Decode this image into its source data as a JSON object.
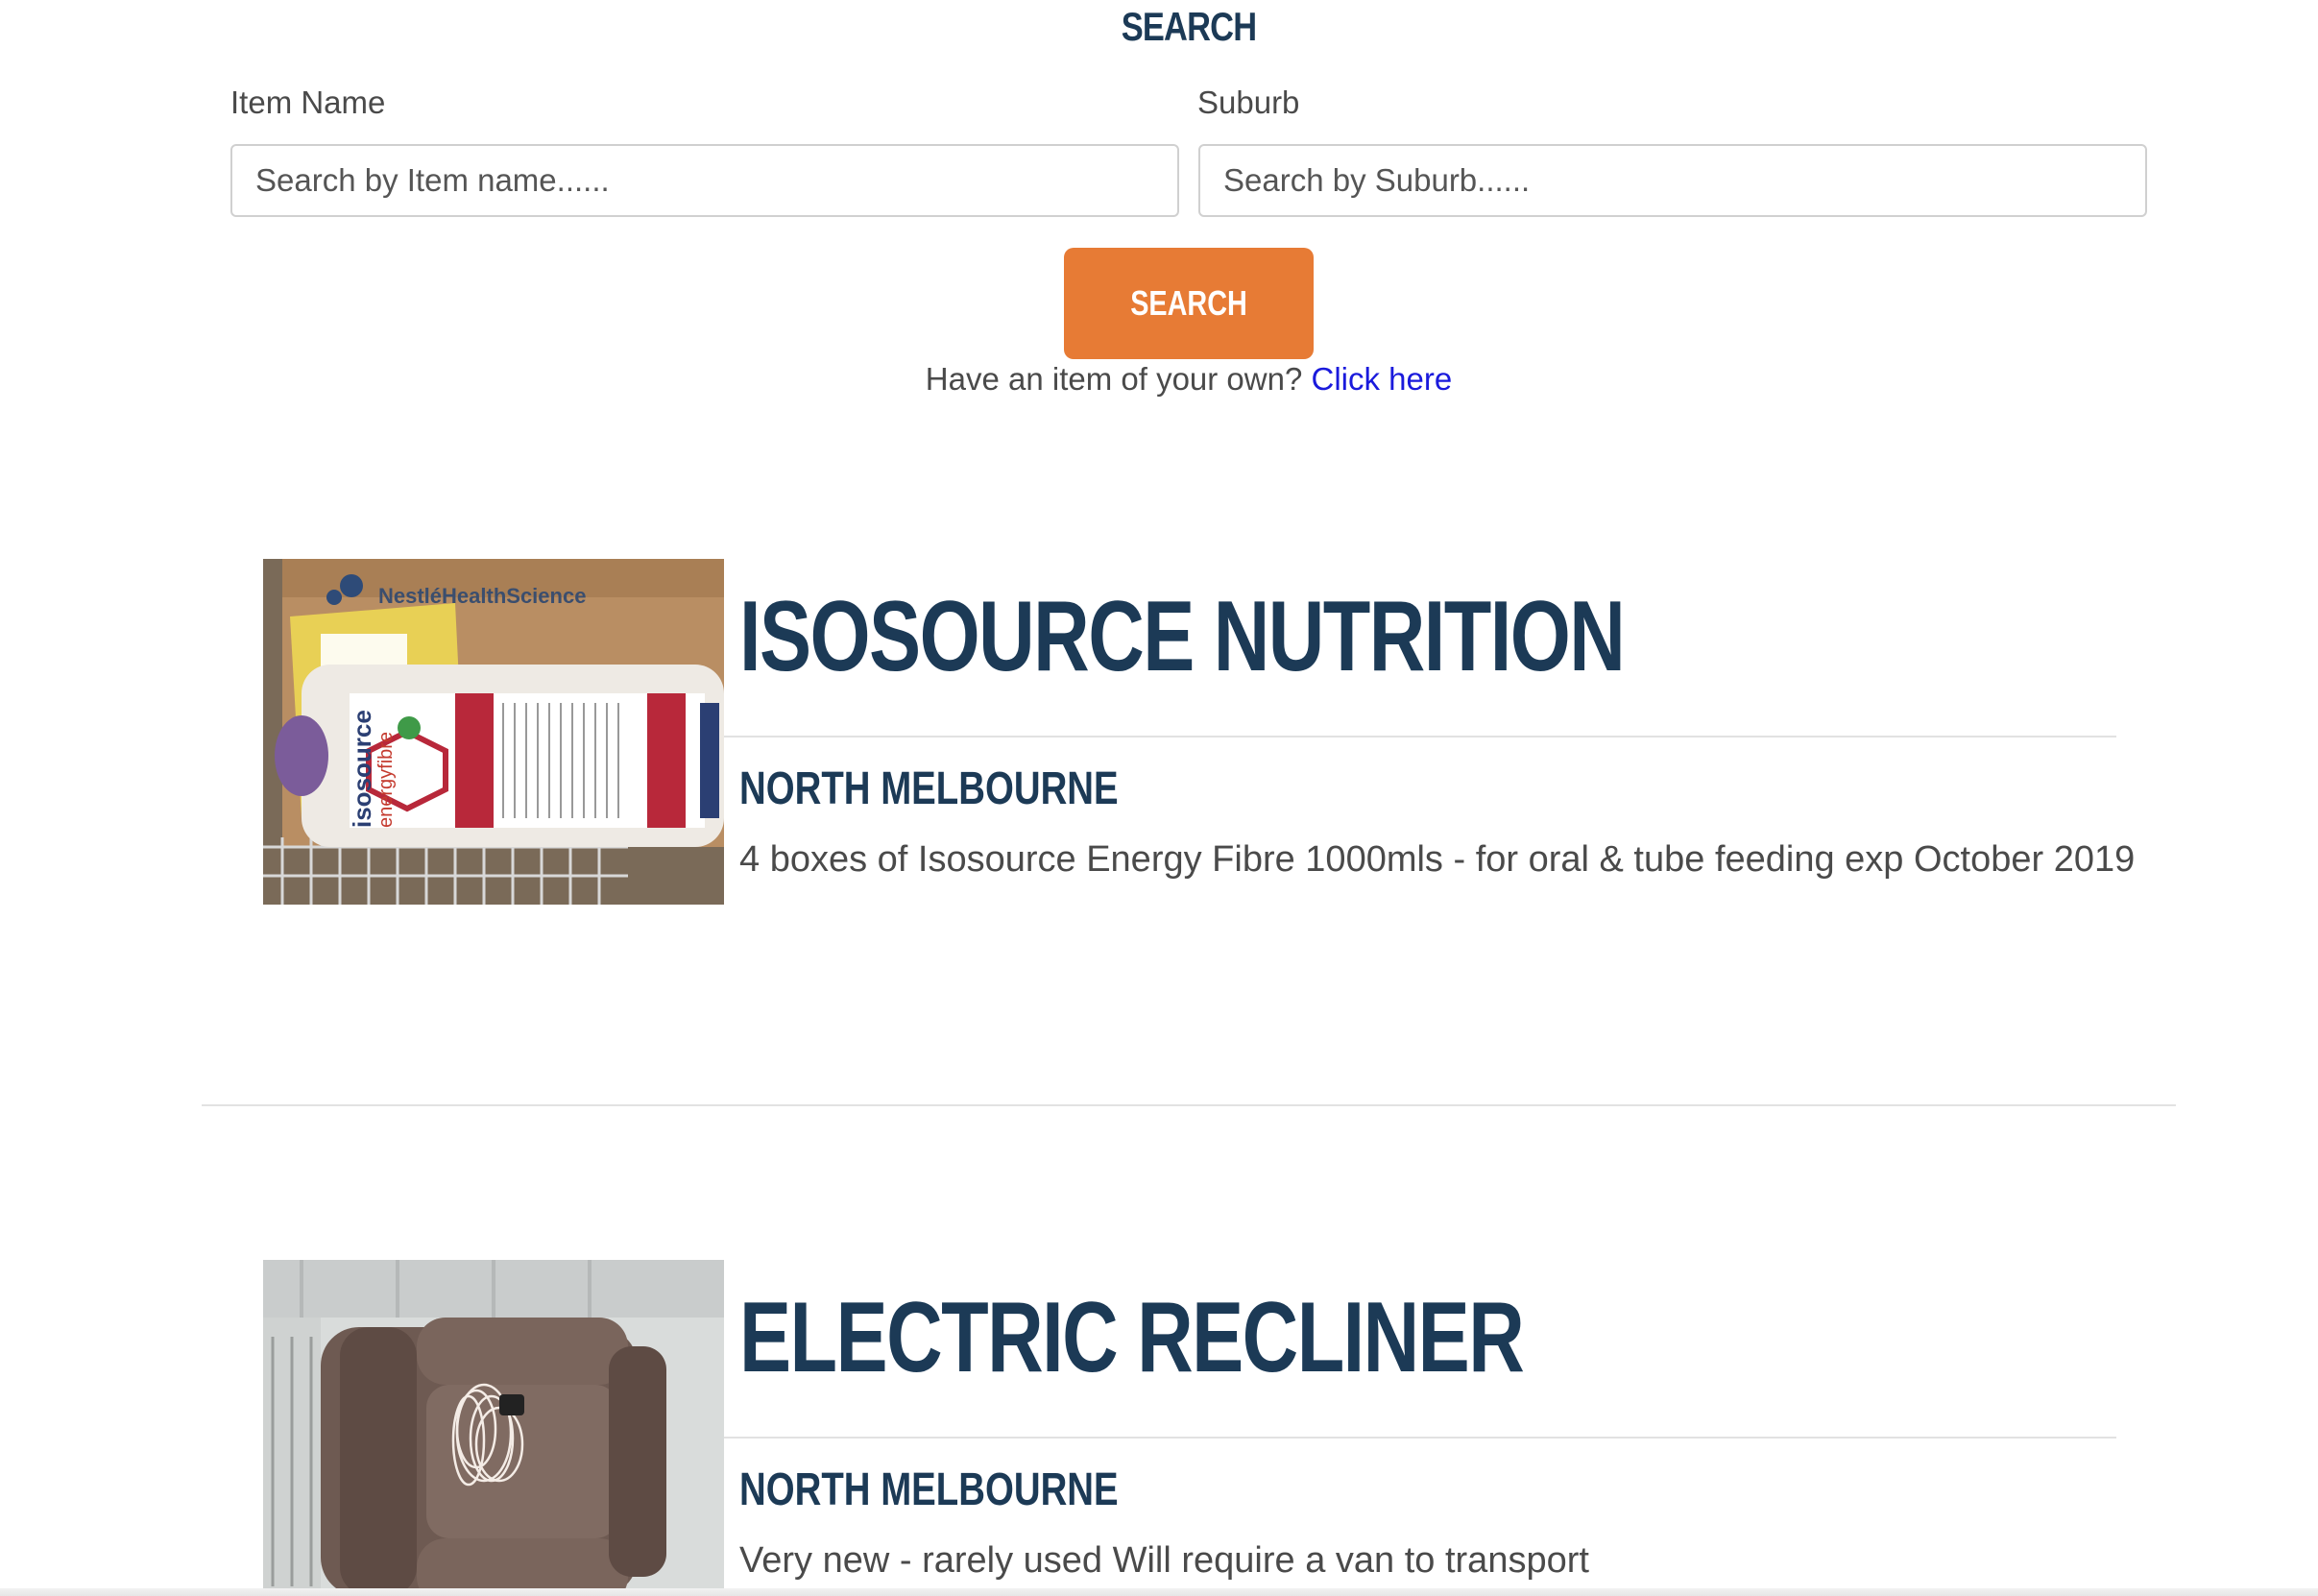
{
  "search": {
    "heading": "SEARCH",
    "item_label": "Item Name",
    "item_placeholder": "Search by Item name......",
    "suburb_label": "Suburb",
    "suburb_placeholder": "Search by Suburb......",
    "button_label": "SEARCH",
    "own_item_text": "Have an item of your own?",
    "own_item_link": "Click here"
  },
  "listings": [
    {
      "title": "ISOSOURCE NUTRITION",
      "suburb": "NORTH MELBOURNE",
      "description": "4 boxes of Isosource Energy Fibre 1000mls - for oral & tube feeding exp October 2019",
      "photo_text": {
        "box_brand": "NestléHealthScience",
        "bottle_brand": "isosource",
        "bottle_variant": "energyfibre"
      }
    },
    {
      "title": "ELECTRIC RECLINER",
      "suburb": "NORTH MELBOURNE",
      "description": "Very new - rarely used Will require a van to transport"
    }
  ],
  "colors": {
    "heading": "#1c3a56",
    "button": "#e77b35",
    "link": "#1a1adc"
  }
}
